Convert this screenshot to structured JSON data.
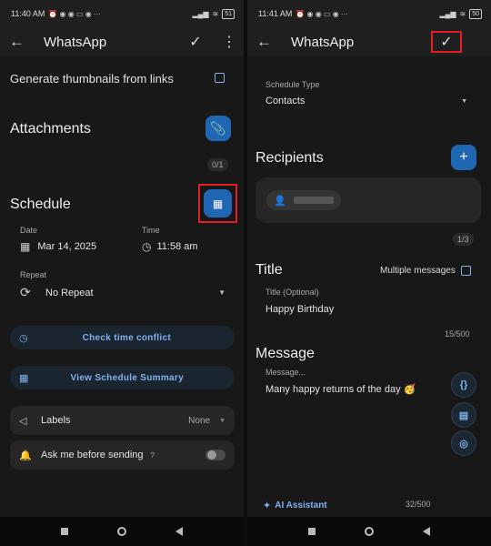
{
  "left": {
    "status": {
      "time": "11:40 AM",
      "battery": "51"
    },
    "appbar": {
      "title": "WhatsApp"
    },
    "thumbnails_label": "Generate thumbnails from links",
    "attachments": {
      "title": "Attachments",
      "count": "0/1"
    },
    "schedule": {
      "title": "Schedule",
      "date_label": "Date",
      "date_value": "Mar 14, 2025",
      "time_label": "Time",
      "time_value": "11:58 am",
      "repeat_label": "Repeat",
      "repeat_value": "No Repeat"
    },
    "buttons": {
      "check_conflict": "Check time conflict",
      "view_summary": "View Schedule Summary"
    },
    "labels_row": {
      "label": "Labels",
      "value": "None"
    },
    "ask_row": {
      "label": "Ask me before sending"
    }
  },
  "right": {
    "status": {
      "time": "11:41 AM",
      "battery": "50"
    },
    "appbar": {
      "title": "WhatsApp"
    },
    "schedule_type": {
      "label": "Schedule Type",
      "value": "Contacts"
    },
    "recipients": {
      "title": "Recipients",
      "count": "1/3"
    },
    "title_section": {
      "title": "Title",
      "multiple_label": "Multiple messages",
      "field_label": "Title (Optional)",
      "value": "Happy Birthday",
      "count": "15/500"
    },
    "message_section": {
      "title": "Message",
      "field_label": "Message...",
      "value": "Many happy returns of the day 🥳",
      "count": "32/500"
    },
    "ai_assistant": "AI Assistant",
    "side_buttons": {
      "braces": "{}"
    }
  },
  "colors": {
    "accent": "#1f66b3",
    "highlight": "#e21f26",
    "link": "#7fb2ef"
  }
}
